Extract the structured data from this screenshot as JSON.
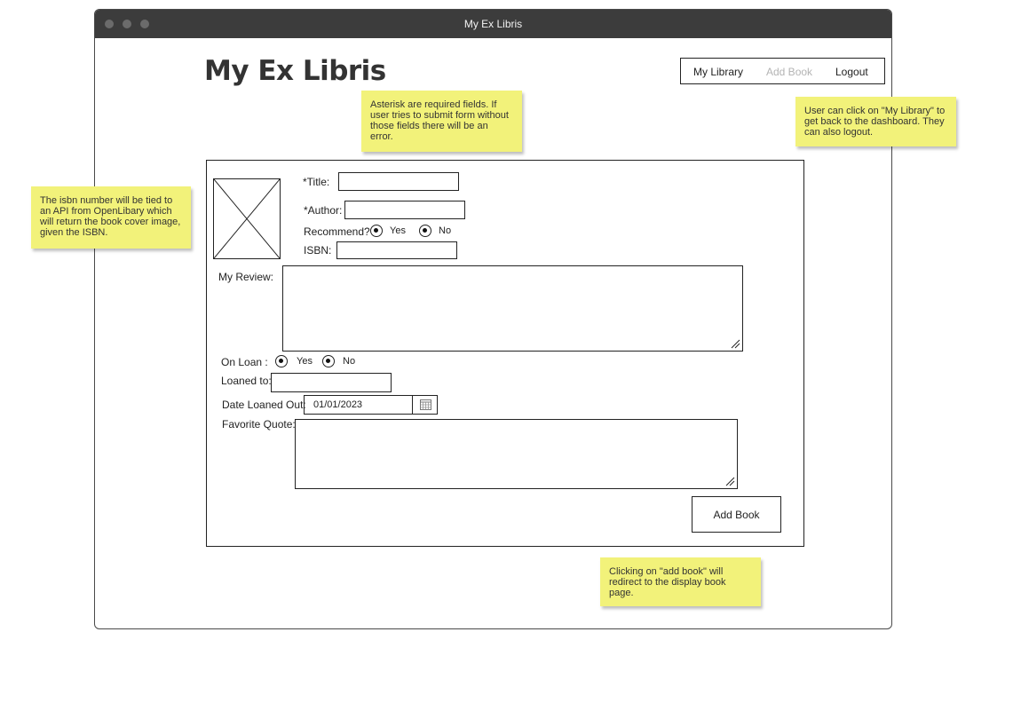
{
  "window": {
    "title": "My Ex Libris"
  },
  "app": {
    "title": "My Ex Libris"
  },
  "nav": {
    "my_library": "My Library",
    "add_book": "Add Book",
    "logout": "Logout"
  },
  "notes": {
    "required": "Asterisk are required fields. If user tries to submit form without those fields there will be an error.",
    "nav_help": "User can click on \"My Library\" to get back to the dashboard. They can also logout.",
    "isbn_help": "The isbn number will be tied to an API from OpenLibary which will return the book cover image, given the ISBN.",
    "add_help": "Clicking on \"add book\" will redirect to the display book page."
  },
  "form": {
    "title_label": "*Title:",
    "author_label": "*Author:",
    "recommend_label": "Recommend?",
    "yes": "Yes",
    "no": "No",
    "isbn_label": "ISBN:",
    "review_label": "My Review:",
    "on_loan_label": "On Loan :",
    "loaned_to_label": "Loaned to:",
    "date_label": "Date Loaned Out:",
    "date_value": "01/01/2023",
    "quote_label": "Favorite Quote:",
    "submit_label": "Add Book"
  },
  "icons": [
    "image-placeholder-icon",
    "calendar-icon",
    "resize-grip-icon"
  ]
}
